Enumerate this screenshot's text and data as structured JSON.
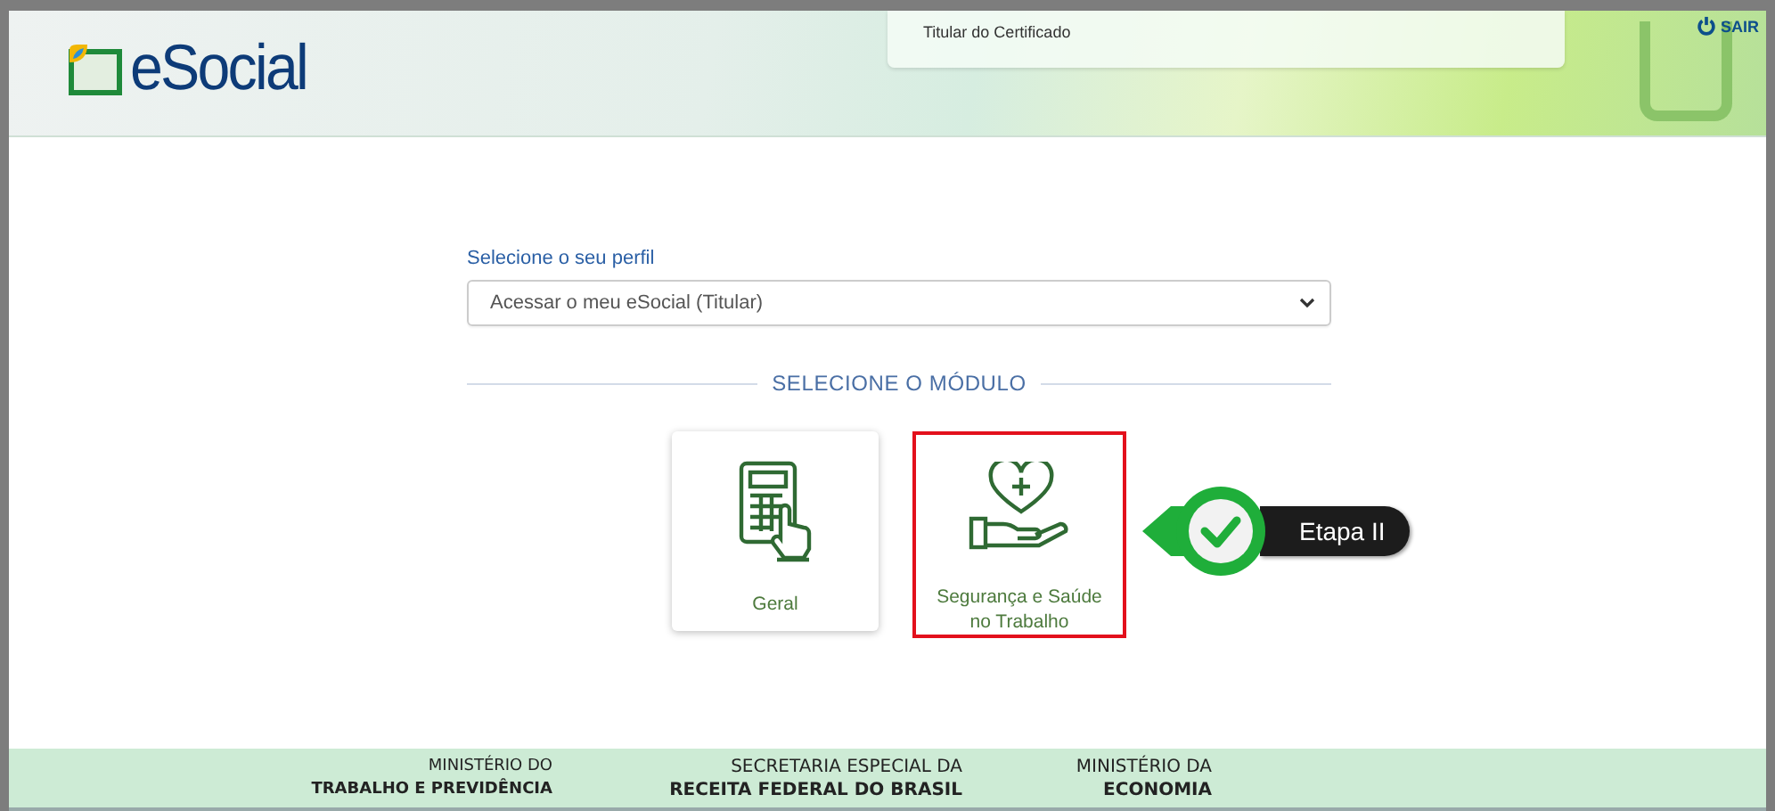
{
  "header": {
    "logo_text": "eSocial",
    "certificate_label": "Titular do Certificado",
    "logout": "SAIR"
  },
  "profile": {
    "label": "Selecione o seu perfil",
    "value": "Acessar o meu eSocial (Titular)"
  },
  "section_title": "SELECIONE O MÓDULO",
  "modules": [
    {
      "kind": "calculator",
      "label": "Geral",
      "selected": false
    },
    {
      "kind": "health",
      "label": "Segurança e Saúde no Trabalho",
      "selected": true
    }
  ],
  "annotation": {
    "label": "Etapa II"
  },
  "footer": [
    {
      "line1": "MINISTÉRIO DO",
      "line2": "TRABALHO E PREVIDÊNCIA"
    },
    {
      "line1": "SECRETARIA ESPECIAL DA",
      "line2": "RECEITA FEDERAL DO BRASIL"
    },
    {
      "line1": "MINISTÉRIO DA",
      "line2": "ECONOMIA"
    }
  ]
}
